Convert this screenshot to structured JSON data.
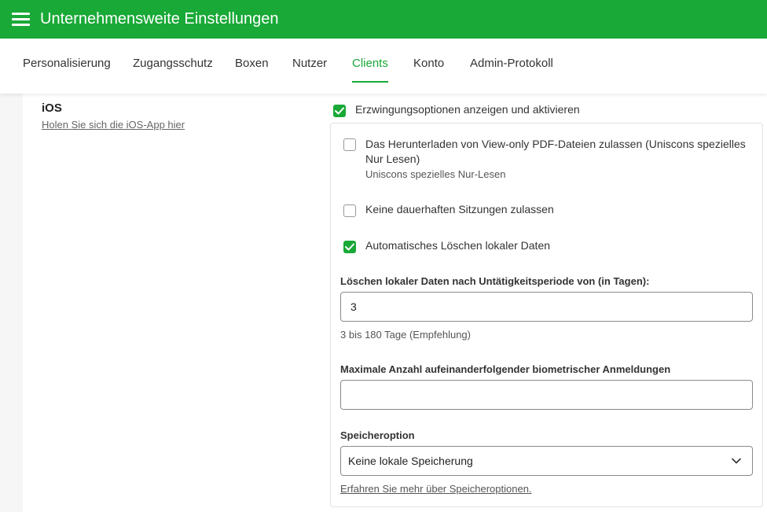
{
  "header": {
    "title": "Unternehmensweite Einstellungen",
    "menu_icon": "hamburger-menu-icon",
    "color": "#19a937"
  },
  "tabs": [
    {
      "label": "Personalisierung",
      "active": false
    },
    {
      "label": "Zugangsschutz",
      "active": false
    },
    {
      "label": "Boxen",
      "active": false
    },
    {
      "label": "Nutzer",
      "active": false
    },
    {
      "label": "Clients",
      "active": true
    },
    {
      "label": "Konto",
      "active": false
    },
    {
      "label": "Admin-Protokoll",
      "active": false
    }
  ],
  "section": {
    "title": "iOS",
    "link": "Holen Sie sich die iOS-App hier"
  },
  "enforce": {
    "label": "Erzwingungsoptionen anzeigen und aktivieren",
    "checked": true
  },
  "options": {
    "viewonly": {
      "label_line1": "Das Herunterladen von View-only PDF-Dateien zulassen (Uniscons spezielles",
      "label_line2": "Nur Lesen)",
      "sub": "Uniscons spezielles Nur-Lesen",
      "checked": false
    },
    "sessions": {
      "label": "Keine dauerhaften Sitzungen zulassen",
      "checked": false
    },
    "autodelete": {
      "label": "Automatisches Löschen lokaler Daten",
      "checked": true
    }
  },
  "fields": {
    "inactivity": {
      "label": "Löschen lokaler Daten nach Untätigkeitsperiode von (in Tagen):",
      "value": "3",
      "hint": "3 bis 180 Tage (Empfehlung)"
    },
    "biometric": {
      "label": "Maximale Anzahl aufeinanderfolgender biometrischer Anmeldungen",
      "value": ""
    },
    "storage": {
      "label": "Speicheroption",
      "selected": "Keine lokale Speicherung",
      "link": "Erfahren Sie mehr über Speicheroptionen."
    }
  }
}
